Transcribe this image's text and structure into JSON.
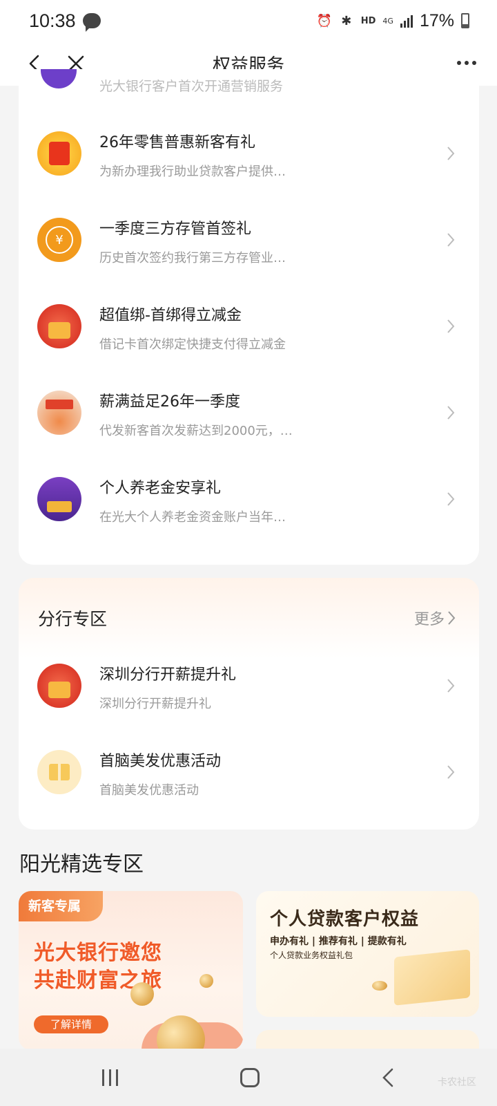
{
  "status_bar": {
    "time": "10:38",
    "hd": "HD",
    "network": "4G",
    "battery": "17%"
  },
  "nav": {
    "title": "权益服务"
  },
  "partial_item": {
    "subtitle": "光大银行客户首次开通营销服务"
  },
  "benefits": [
    {
      "title": "26年零售普惠新客有礼",
      "subtitle": "为新办理我行助业贷款客户提供…",
      "icon": "gift-bag-icon"
    },
    {
      "title": "一季度三方存管首签礼",
      "subtitle": "历史首次签约我行第三方存管业…",
      "icon": "yuan-coin-icon"
    },
    {
      "title": "超值绑-首绑得立减金",
      "subtitle": "借记卡首次绑定快捷支付得立减金",
      "icon": "treasure-box-icon"
    },
    {
      "title": "薪满益足26年一季度",
      "subtitle": "代发新客首次发薪达到2000元，…",
      "icon": "salary-promo-icon"
    },
    {
      "title": "个人养老金安享礼",
      "subtitle": "在光大个人养老金资金账户当年…",
      "icon": "pension-promo-icon"
    }
  ],
  "branch": {
    "title": "分行专区",
    "more": "更多",
    "items": [
      {
        "title": "深圳分行开薪提升礼",
        "subtitle": "深圳分行开薪提升礼",
        "icon": "treasure-box-icon"
      },
      {
        "title": "首脑美发优惠活动",
        "subtitle": "首脑美发优惠活动",
        "icon": "gift-icon"
      }
    ]
  },
  "sunshine": {
    "title": "阳光精选专区",
    "left_card": {
      "tag": "新客专属",
      "line1": "光大银行邀您",
      "line2": "共赴财富之旅",
      "button": "了解详情"
    },
    "right_card": {
      "title": "个人贷款客户权益",
      "tags": "申办有礼 | 推荐有礼 | 提款有礼",
      "subtitle": "个人贷款业务权益礼包"
    }
  },
  "bottom_nav": {
    "watermark": "卡农社区"
  },
  "colors": {
    "accent": "#f05a28",
    "background": "#f4f4f4"
  }
}
